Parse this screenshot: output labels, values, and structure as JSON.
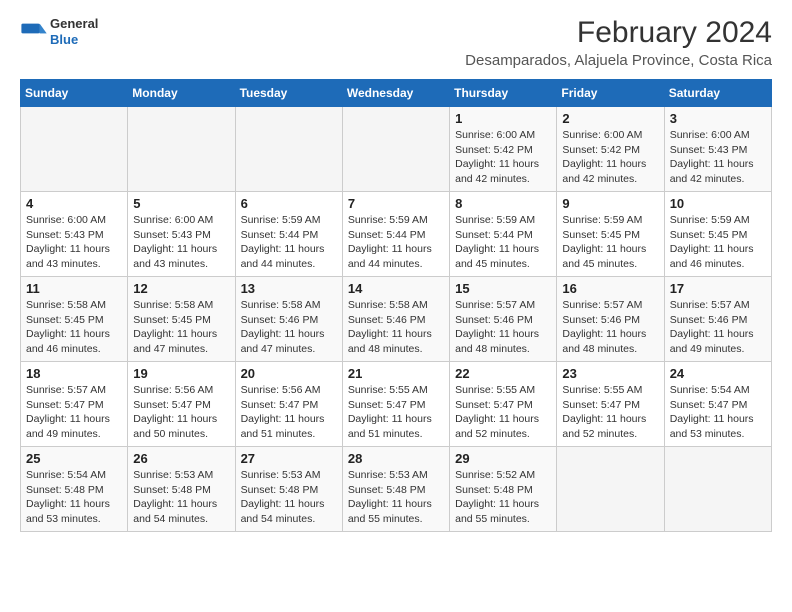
{
  "title": "February 2024",
  "subtitle": "Desamparados, Alajuela Province, Costa Rica",
  "logo": {
    "line1": "General",
    "line2": "Blue"
  },
  "days_of_week": [
    "Sunday",
    "Monday",
    "Tuesday",
    "Wednesday",
    "Thursday",
    "Friday",
    "Saturday"
  ],
  "weeks": [
    [
      {
        "day": "",
        "info": ""
      },
      {
        "day": "",
        "info": ""
      },
      {
        "day": "",
        "info": ""
      },
      {
        "day": "",
        "info": ""
      },
      {
        "day": "1",
        "info": "Sunrise: 6:00 AM\nSunset: 5:42 PM\nDaylight: 11 hours\nand 42 minutes."
      },
      {
        "day": "2",
        "info": "Sunrise: 6:00 AM\nSunset: 5:42 PM\nDaylight: 11 hours\nand 42 minutes."
      },
      {
        "day": "3",
        "info": "Sunrise: 6:00 AM\nSunset: 5:43 PM\nDaylight: 11 hours\nand 42 minutes."
      }
    ],
    [
      {
        "day": "4",
        "info": "Sunrise: 6:00 AM\nSunset: 5:43 PM\nDaylight: 11 hours\nand 43 minutes."
      },
      {
        "day": "5",
        "info": "Sunrise: 6:00 AM\nSunset: 5:43 PM\nDaylight: 11 hours\nand 43 minutes."
      },
      {
        "day": "6",
        "info": "Sunrise: 5:59 AM\nSunset: 5:44 PM\nDaylight: 11 hours\nand 44 minutes."
      },
      {
        "day": "7",
        "info": "Sunrise: 5:59 AM\nSunset: 5:44 PM\nDaylight: 11 hours\nand 44 minutes."
      },
      {
        "day": "8",
        "info": "Sunrise: 5:59 AM\nSunset: 5:44 PM\nDaylight: 11 hours\nand 45 minutes."
      },
      {
        "day": "9",
        "info": "Sunrise: 5:59 AM\nSunset: 5:45 PM\nDaylight: 11 hours\nand 45 minutes."
      },
      {
        "day": "10",
        "info": "Sunrise: 5:59 AM\nSunset: 5:45 PM\nDaylight: 11 hours\nand 46 minutes."
      }
    ],
    [
      {
        "day": "11",
        "info": "Sunrise: 5:58 AM\nSunset: 5:45 PM\nDaylight: 11 hours\nand 46 minutes."
      },
      {
        "day": "12",
        "info": "Sunrise: 5:58 AM\nSunset: 5:45 PM\nDaylight: 11 hours\nand 47 minutes."
      },
      {
        "day": "13",
        "info": "Sunrise: 5:58 AM\nSunset: 5:46 PM\nDaylight: 11 hours\nand 47 minutes."
      },
      {
        "day": "14",
        "info": "Sunrise: 5:58 AM\nSunset: 5:46 PM\nDaylight: 11 hours\nand 48 minutes."
      },
      {
        "day": "15",
        "info": "Sunrise: 5:57 AM\nSunset: 5:46 PM\nDaylight: 11 hours\nand 48 minutes."
      },
      {
        "day": "16",
        "info": "Sunrise: 5:57 AM\nSunset: 5:46 PM\nDaylight: 11 hours\nand 48 minutes."
      },
      {
        "day": "17",
        "info": "Sunrise: 5:57 AM\nSunset: 5:46 PM\nDaylight: 11 hours\nand 49 minutes."
      }
    ],
    [
      {
        "day": "18",
        "info": "Sunrise: 5:57 AM\nSunset: 5:47 PM\nDaylight: 11 hours\nand 49 minutes."
      },
      {
        "day": "19",
        "info": "Sunrise: 5:56 AM\nSunset: 5:47 PM\nDaylight: 11 hours\nand 50 minutes."
      },
      {
        "day": "20",
        "info": "Sunrise: 5:56 AM\nSunset: 5:47 PM\nDaylight: 11 hours\nand 51 minutes."
      },
      {
        "day": "21",
        "info": "Sunrise: 5:55 AM\nSunset: 5:47 PM\nDaylight: 11 hours\nand 51 minutes."
      },
      {
        "day": "22",
        "info": "Sunrise: 5:55 AM\nSunset: 5:47 PM\nDaylight: 11 hours\nand 52 minutes."
      },
      {
        "day": "23",
        "info": "Sunrise: 5:55 AM\nSunset: 5:47 PM\nDaylight: 11 hours\nand 52 minutes."
      },
      {
        "day": "24",
        "info": "Sunrise: 5:54 AM\nSunset: 5:47 PM\nDaylight: 11 hours\nand 53 minutes."
      }
    ],
    [
      {
        "day": "25",
        "info": "Sunrise: 5:54 AM\nSunset: 5:48 PM\nDaylight: 11 hours\nand 53 minutes."
      },
      {
        "day": "26",
        "info": "Sunrise: 5:53 AM\nSunset: 5:48 PM\nDaylight: 11 hours\nand 54 minutes."
      },
      {
        "day": "27",
        "info": "Sunrise: 5:53 AM\nSunset: 5:48 PM\nDaylight: 11 hours\nand 54 minutes."
      },
      {
        "day": "28",
        "info": "Sunrise: 5:53 AM\nSunset: 5:48 PM\nDaylight: 11 hours\nand 55 minutes."
      },
      {
        "day": "29",
        "info": "Sunrise: 5:52 AM\nSunset: 5:48 PM\nDaylight: 11 hours\nand 55 minutes."
      },
      {
        "day": "",
        "info": ""
      },
      {
        "day": "",
        "info": ""
      }
    ]
  ]
}
